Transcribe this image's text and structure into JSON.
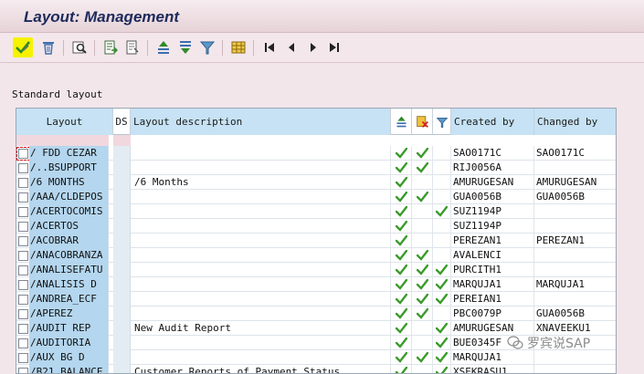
{
  "window": {
    "title": "Layout: Management"
  },
  "toolbar": {
    "buttons": [
      "choose-icon",
      "delete-icon",
      "find-icon",
      "export-icon",
      "import-icon",
      "sort-ascending-icon",
      "sort-descending-icon",
      "filter-icon",
      "layout-grid-icon",
      "first-page-icon",
      "previous-page-icon",
      "next-page-icon",
      "last-page-icon"
    ]
  },
  "standard_label": "Standard layout",
  "table": {
    "headers": {
      "layout": "Layout",
      "ds": "DS",
      "description": "Layout description",
      "col1_icon": "sort-icon",
      "col2_icon": "user-specific-icon",
      "col3_icon": "filter-icon",
      "created_by": "Created by",
      "changed_by": "Changed by"
    },
    "rows": [
      {
        "layout": "/ FDD CEZAR",
        "desc": "",
        "c1": true,
        "c2": true,
        "c3": false,
        "created": "SAO0171C",
        "changed": "SAO0171C"
      },
      {
        "layout": "/..BSUPPORT",
        "desc": "",
        "c1": true,
        "c2": true,
        "c3": false,
        "created": "RIJ0056A",
        "changed": ""
      },
      {
        "layout": "/6 MONTHS",
        "desc": "/6 Months",
        "c1": true,
        "c2": false,
        "c3": false,
        "created": "AMURUGESAN",
        "changed": "AMURUGESAN"
      },
      {
        "layout": "/AAA/CLDEPOS",
        "desc": "",
        "c1": true,
        "c2": true,
        "c3": false,
        "created": "GUA0056B",
        "changed": "GUA0056B"
      },
      {
        "layout": "/ACERTOCOMIS",
        "desc": "",
        "c1": true,
        "c2": false,
        "c3": true,
        "created": "SUZ1194P",
        "changed": ""
      },
      {
        "layout": "/ACERTOS",
        "desc": "",
        "c1": true,
        "c2": false,
        "c3": false,
        "created": "SUZ1194P",
        "changed": ""
      },
      {
        "layout": "/ACOBRAR",
        "desc": "",
        "c1": true,
        "c2": false,
        "c3": false,
        "created": "PEREZAN1",
        "changed": "PEREZAN1"
      },
      {
        "layout": "/ANACOBRANZA",
        "desc": "",
        "c1": true,
        "c2": true,
        "c3": false,
        "created": "AVALENCI",
        "changed": ""
      },
      {
        "layout": "/ANALISEFATU",
        "desc": "",
        "c1": true,
        "c2": true,
        "c3": true,
        "created": "PURCITH1",
        "changed": ""
      },
      {
        "layout": "/ANALISIS D",
        "desc": "",
        "c1": true,
        "c2": true,
        "c3": true,
        "created": "MARQUJA1",
        "changed": "MARQUJA1"
      },
      {
        "layout": "/ANDREA_ECF",
        "desc": "",
        "c1": true,
        "c2": true,
        "c3": true,
        "created": "PEREIAN1",
        "changed": ""
      },
      {
        "layout": "/APEREZ",
        "desc": "",
        "c1": true,
        "c2": true,
        "c3": false,
        "created": "PBC0079P",
        "changed": "GUA0056B"
      },
      {
        "layout": "/AUDIT REP",
        "desc": "New Audit Report",
        "c1": true,
        "c2": false,
        "c3": true,
        "created": "AMURUGESAN",
        "changed": "XNAVEEKU1"
      },
      {
        "layout": "/AUDITORIA",
        "desc": "",
        "c1": true,
        "c2": false,
        "c3": true,
        "created": "BUE0345F",
        "changed": ""
      },
      {
        "layout": "/AUX BG D",
        "desc": "",
        "c1": true,
        "c2": true,
        "c3": true,
        "created": "MARQUJA1",
        "changed": ""
      },
      {
        "layout": "/B21 BALANCE",
        "desc": "Customer Reports of Payment Status",
        "c1": true,
        "c2": false,
        "c3": true,
        "created": "XSEKRASU1",
        "changed": ""
      }
    ]
  },
  "watermark": "罗宾说SAP",
  "colors": {
    "title_text": "#1d2a5c",
    "check_green": "#3a9b2a",
    "layout_col_bg": "#b4d6ee",
    "header_blue": "#c6e2f4",
    "toolbar_highlight": "#f6f200"
  }
}
